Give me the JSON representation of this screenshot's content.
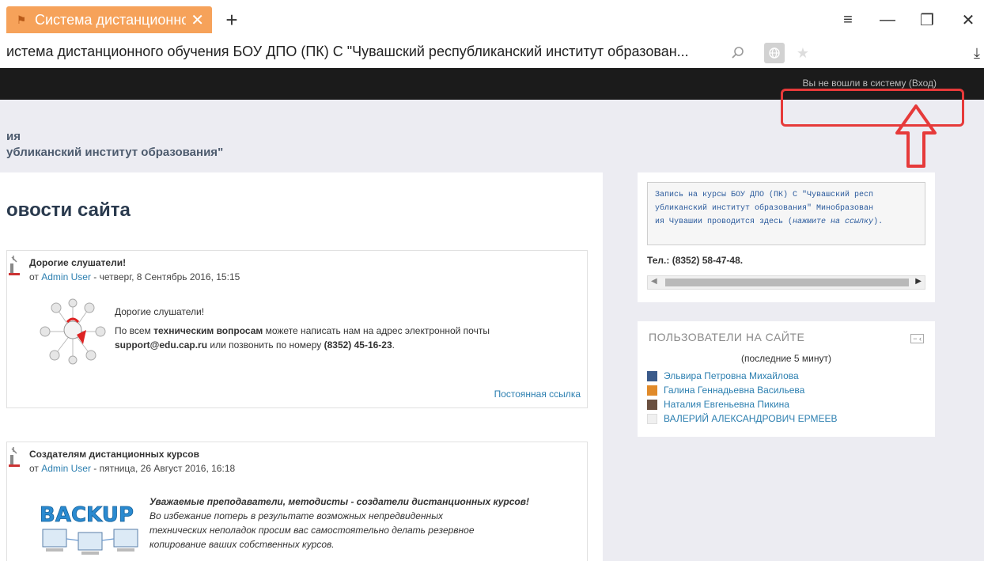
{
  "browser": {
    "tab_title": "Система дистанционног",
    "tab_close": "✕",
    "new_tab": "+",
    "menu_icon": "hamburger-icon",
    "win_controls": {
      "menu": "≡",
      "minimize": "—",
      "restore": "❐",
      "close": "✕"
    },
    "address": "истема дистанционного обучения БОУ ДПО (ПК) С \"Чувашский республиканский институт образован...",
    "download": "⤓"
  },
  "navbar": {
    "login_text": "Вы не вошли в систему (",
    "login_link": "Вход",
    "login_end": ")"
  },
  "header": {
    "line1": "ия",
    "line2": "убликанский институт образования\""
  },
  "main": {
    "title": "овости сайта",
    "posts": [
      {
        "subject": "Дорогие слушатели!",
        "by_prefix": "от ",
        "author": "Admin User",
        "date": " - четверг, 8 Сентябрь 2016, 15:15",
        "greeting": "Дорогие слушатели!",
        "text_1": "По всем ",
        "text_bold": "техническим вопросам",
        "text_2": " можете написать нам на адрес электронной почты",
        "email": "support@edu.cap.ru",
        "text_3": " или позвонить по номеру ",
        "phone": "(8352) 45-16-23",
        "text_4": ".",
        "permalink": "Постоянная ссылка"
      },
      {
        "subject": "Создателям дистанционных курсов",
        "by_prefix": "от ",
        "author": "Admin User",
        "date": " - пятница, 26 Август 2016, 16:18",
        "image_text": "BACKUP",
        "line1": "Уважаемые преподаватели, методисты - создатели дистанционных курсов!",
        "line2": "Во избежание потерь в результате возможных непредвиденных",
        "line3": "технических неполадок просим вас самостоятельно делать резервное",
        "line4": "копирование ваших собственных курсов."
      }
    ]
  },
  "sidebar": {
    "notice_1": "Запись на курсы БОУ ДПО (ПК) С \"Чувашский респ",
    "notice_2": "убликанский институт образования\" Минобразован",
    "notice_3": "ия Чувашии проводится здесь (",
    "notice_link": "нажмите на ссылку",
    "notice_end": ").",
    "phone": "Тел.: (8352) 58-47-48.",
    "online": {
      "title": "ПОЛЬЗОВАТЕЛИ НА САЙТЕ",
      "subtitle": "(последние 5 минут)",
      "users": [
        "Эльвира Петровна Михайлова",
        "Галина Геннадьевна Васильева",
        "Наталия Евгеньевна Пикина",
        "ВАЛЕРИЙ АЛЕКСАНДРОВИЧ ЕРМЕЕВ"
      ]
    }
  },
  "colors": {
    "accent_tab": "#f6a25a",
    "navbar": "#1b1b1b",
    "link": "#2c7fb0",
    "annotation": "#e63a3a"
  }
}
